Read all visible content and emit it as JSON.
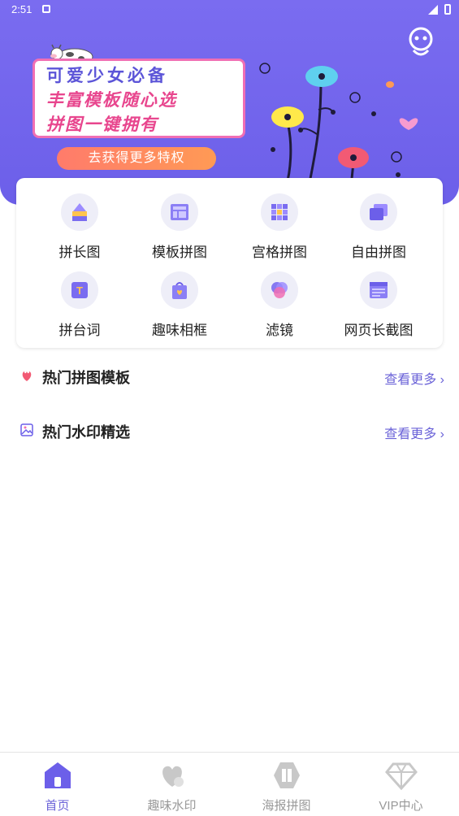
{
  "status_bar": {
    "time": "2:51"
  },
  "hero": {
    "promo_lines": [
      "可爱少女必备",
      "丰富模板随心选",
      "拼图一键拥有"
    ],
    "privilege_button": "去获得更多特权"
  },
  "tools": [
    {
      "label": "拼长图",
      "icon": "long-stitch-icon"
    },
    {
      "label": "模板拼图",
      "icon": "template-collage-icon"
    },
    {
      "label": "宫格拼图",
      "icon": "grid-collage-icon"
    },
    {
      "label": "自由拼图",
      "icon": "free-collage-icon"
    },
    {
      "label": "拼台词",
      "icon": "subtitle-stitch-icon"
    },
    {
      "label": "趣味相框",
      "icon": "fun-frame-icon"
    },
    {
      "label": "滤镜",
      "icon": "filter-icon"
    },
    {
      "label": "网页长截图",
      "icon": "webpage-screenshot-icon"
    }
  ],
  "sections": [
    {
      "title": "热门拼图模板",
      "more": "查看更多 ›",
      "icon": "hot-template-icon"
    },
    {
      "title": "热门水印精选",
      "more": "查看更多 ›",
      "icon": "watermark-icon"
    }
  ],
  "nav": [
    {
      "label": "首页",
      "icon": "home-icon",
      "active": true
    },
    {
      "label": "趣味水印",
      "icon": "fun-watermark-icon",
      "active": false
    },
    {
      "label": "海报拼图",
      "icon": "poster-collage-icon",
      "active": false
    },
    {
      "label": "VIP中心",
      "icon": "vip-diamond-icon",
      "active": false
    }
  ],
  "colors": {
    "primary": "#6c5fe9",
    "accent_pink": "#e8468e",
    "link": "#6b63d8"
  }
}
